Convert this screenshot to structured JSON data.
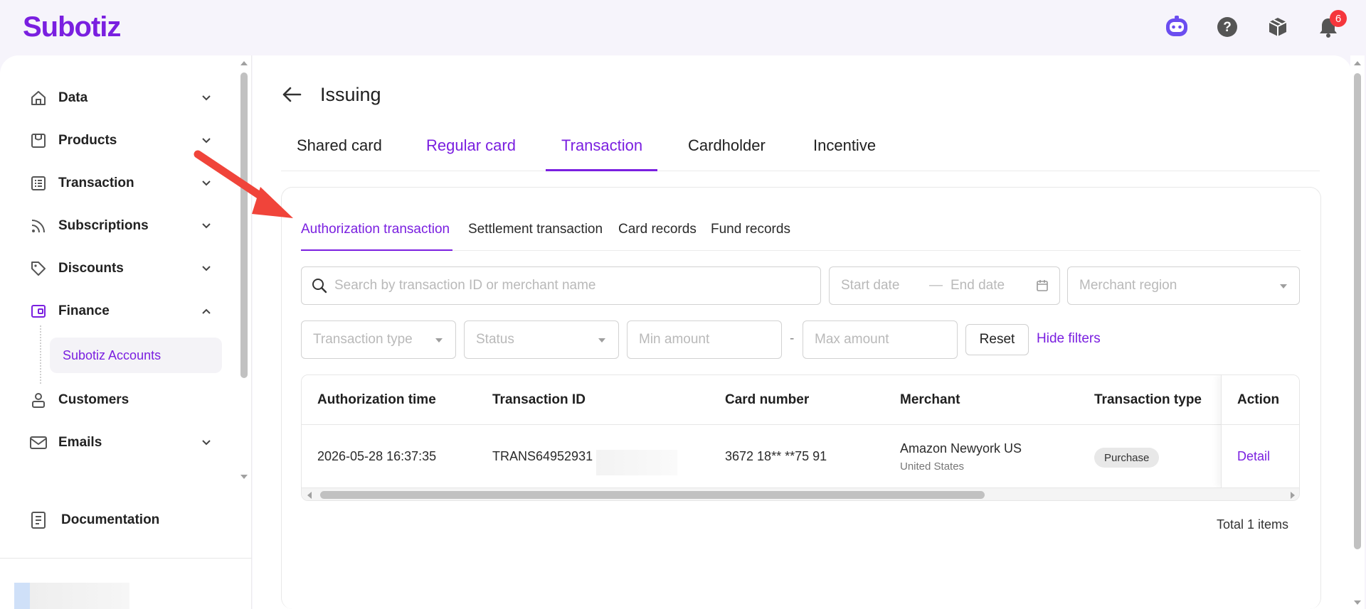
{
  "brand": {
    "name": "Subotiz",
    "accent": "#7a1fe0"
  },
  "topbar": {
    "notification_count": "6",
    "icons": [
      "bot-icon",
      "help-icon",
      "package-icon",
      "bell-icon"
    ]
  },
  "sidebar": {
    "items": [
      {
        "label": "Data",
        "icon": "home-icon"
      },
      {
        "label": "Products",
        "icon": "store-icon"
      },
      {
        "label": "Transaction",
        "icon": "list-icon"
      },
      {
        "label": "Subscriptions",
        "icon": "rss-icon"
      },
      {
        "label": "Discounts",
        "icon": "tag-icon"
      },
      {
        "label": "Finance",
        "icon": "wallet-icon"
      },
      {
        "label": "Customers",
        "icon": "user-icon"
      },
      {
        "label": "Emails",
        "icon": "mail-icon"
      }
    ],
    "sub_item": "Subotiz Accounts",
    "documentation": "Documentation"
  },
  "page": {
    "title": "Issuing",
    "tabs": [
      "Shared card",
      "Regular card",
      "Transaction",
      "Cardholder",
      "Incentive"
    ],
    "subtabs": [
      "Authorization transaction",
      "Settlement transaction",
      "Card records",
      "Fund records"
    ]
  },
  "filters": {
    "search_placeholder": "Search by transaction ID or merchant name",
    "start_date": "Start date",
    "date_sep": "—",
    "end_date": "End date",
    "merchant_region": "Merchant region",
    "transaction_type": "Transaction type",
    "status": "Status",
    "min_amount": "Min amount",
    "range_sep": "-",
    "max_amount": "Max amount",
    "reset": "Reset",
    "hide_filters": "Hide filters"
  },
  "table": {
    "columns": [
      "Authorization time",
      "Transaction ID",
      "Card number",
      "Merchant",
      "Transaction type",
      "Action"
    ],
    "rows": [
      {
        "time": "2026-05-28 16:37:35",
        "transaction_id": "TRANS64952931",
        "card_number": "3672 18** **75 91",
        "merchant": "Amazon Newyork US",
        "merchant_region": "United States",
        "type": "Purchase",
        "action": "Detail"
      }
    ],
    "total": "Total 1 items"
  }
}
